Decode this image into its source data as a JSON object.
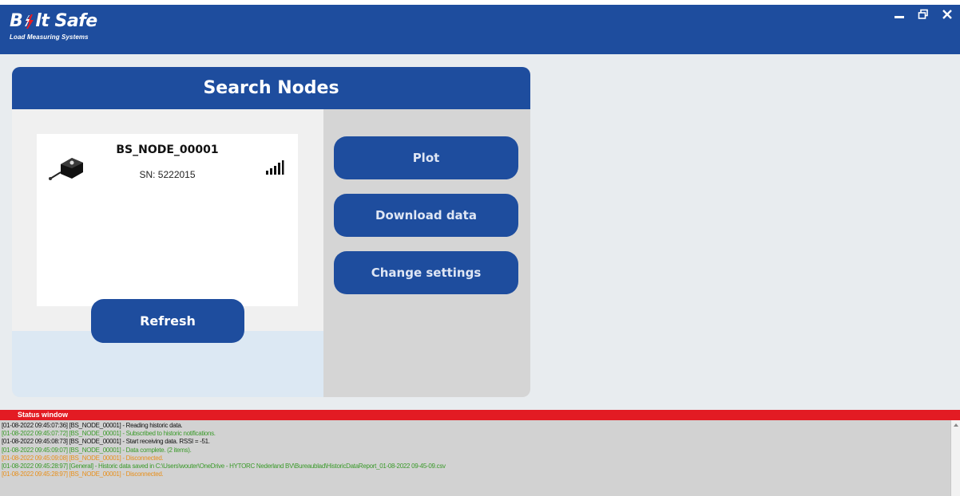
{
  "header": {
    "brand_left": "B",
    "brand_right": "lt Safe",
    "tagline": "Load Measuring Systems",
    "minimize": "▬",
    "restore": "⧉",
    "close": "✕"
  },
  "panel": {
    "title": "Search Nodes",
    "node": {
      "name": "BS_NODE_00001",
      "sn": "SN: 5222015",
      "signal_bars_filled": 5
    },
    "buttons": {
      "refresh": "Refresh",
      "plot": "Plot",
      "download": "Download data",
      "settings": "Change settings"
    }
  },
  "status": {
    "title": "Status window",
    "lines": [
      {
        "text": "[01-08-2022 09:45:07:36] [BS_NODE_00001] - Reading historic data.",
        "color": "#111111"
      },
      {
        "text": "[01-08-2022 09:45:07:72] [BS_NODE_00001] - Subscribed to historic notifications.",
        "color": "#3a9a2a"
      },
      {
        "text": "[01-08-2022 09:45:08:73] [BS_NODE_00001] - Start receiving data. RSSI = -51.",
        "color": "#111111"
      },
      {
        "text": "[01-08-2022 09:45:09:07] [BS_NODE_00001] - Data complete. (2 items).",
        "color": "#3a9a2a"
      },
      {
        "text": "[01-08-2022 09:45:09:08] [BS_NODE_00001] - Disconnected.",
        "color": "#e8901c"
      },
      {
        "text": "[01-08-2022 09:45:28:97] [General] - Historic data saved in C:\\Users\\wouter\\OneDrive - HYTORC Nederland BV\\Bureaublad\\HistoricDataReport_01-08-2022 09-45-09.csv",
        "color": "#3a9a2a"
      },
      {
        "text": "[01-08-2022 09:45:28:97] [BS_NODE_00001] - Disconnected.",
        "color": "#e8901c"
      }
    ]
  },
  "colors": {
    "brand_blue": "#1e4d9e",
    "status_red": "#e31b23"
  }
}
